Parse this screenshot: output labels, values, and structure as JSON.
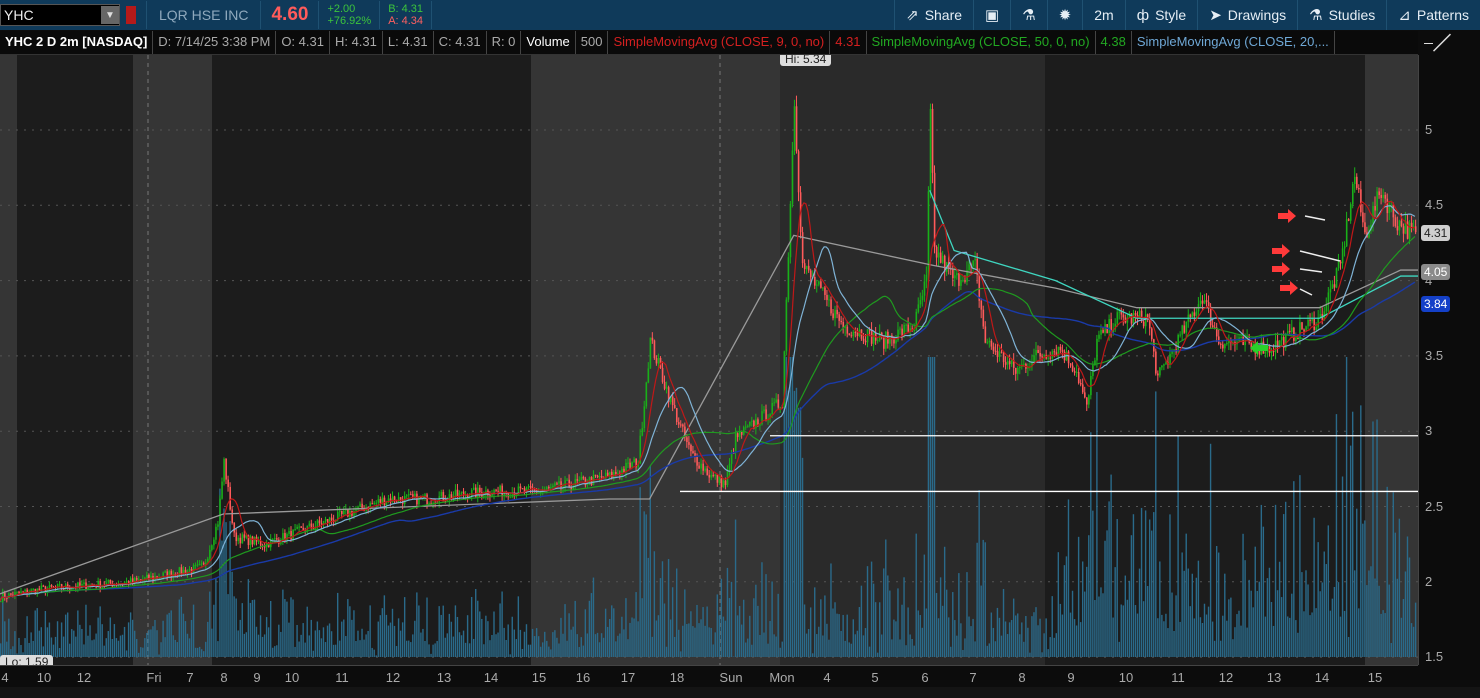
{
  "header": {
    "symbol": "YHC",
    "company": "LQR HSE INC",
    "last": "4.60",
    "change": "+2.00",
    "change_pct": "+76.92%",
    "bid": "B: 4.31",
    "ask": "A: 4.34"
  },
  "toolbar": {
    "share": "Share",
    "timeframe": "2m",
    "style": "Style",
    "drawings": "Drawings",
    "studies": "Studies",
    "patterns": "Patterns"
  },
  "studybar": {
    "title": "YHC 2 D 2m [NASDAQ]",
    "date": "D: 7/14/25 3:38 PM",
    "open": "O: 4.31",
    "high": "H: 4.31",
    "low": "L: 4.31",
    "close": "C: 4.31",
    "range": "R: 0",
    "volume_label": "Volume",
    "volume": "500",
    "sma9": "SimpleMovingAvg (CLOSE, 9, 0, no)",
    "sma9_val": "4.31",
    "sma50": "SimpleMovingAvg (CLOSE, 50, 0, no)",
    "sma50_val": "4.38",
    "sma20": "SimpleMovingAvg (CLOSE, 20,..."
  },
  "chart": {
    "hi_label": "Hi: 5.34",
    "lo_label": "Lo: 1.59",
    "price_ticks": [
      "5",
      "4.5",
      "4",
      "3.5",
      "3",
      "2.5",
      "2",
      "1.5"
    ],
    "price_tick_values": [
      5,
      4.5,
      4,
      3.5,
      3,
      2.5,
      2,
      1.5
    ],
    "markers": [
      {
        "label": "4.31",
        "value": 4.31,
        "bg": "#cfcfcf",
        "fg": "#222"
      },
      {
        "label": "4.05",
        "value": 4.05,
        "bg": "#8a8a8a",
        "fg": "#fff"
      },
      {
        "label": "3.84",
        "value": 3.84,
        "bg": "#1440c8",
        "fg": "#fff"
      }
    ],
    "time_labels": [
      "4",
      "10",
      "12",
      "Fri",
      "7",
      "8",
      "9",
      "10",
      "11",
      "12",
      "13",
      "14",
      "15",
      "16",
      "17",
      "18",
      "Sun",
      "Mon",
      "4",
      "5",
      "6",
      "7",
      "8",
      "9",
      "10",
      "11",
      "12",
      "13",
      "14",
      "15"
    ],
    "horizontal_lines": [
      2.97,
      2.6
    ],
    "colors": {
      "up": "#19b019",
      "down": "#ff5a5a",
      "sma9": "#c01818",
      "sma20": "#7fb3d6",
      "sma50": "#1f9a1f",
      "sma200": "#1a3aa8",
      "vwap_grey": "#9a9a9a",
      "vwap_teal": "#3fd6c0",
      "volume": "#2a6a8a"
    }
  },
  "chart_data": {
    "type": "candlestick",
    "ylim": [
      1.45,
      5.5
    ],
    "price_keypoints": [
      [
        0,
        1.9
      ],
      [
        20,
        1.95
      ],
      [
        65,
        2.0
      ],
      [
        100,
        2.1
      ],
      [
        107,
        2.4
      ],
      [
        110,
        2.8
      ],
      [
        115,
        2.3
      ],
      [
        130,
        2.25
      ],
      [
        150,
        2.35
      ],
      [
        170,
        2.45
      ],
      [
        190,
        2.55
      ],
      [
        210,
        2.55
      ],
      [
        240,
        2.6
      ],
      [
        265,
        2.6
      ],
      [
        300,
        2.7
      ],
      [
        314,
        2.8
      ],
      [
        320,
        3.6
      ],
      [
        330,
        3.2
      ],
      [
        340,
        2.85
      ],
      [
        350,
        2.7
      ],
      [
        357,
        2.65
      ],
      [
        362,
        2.95
      ],
      [
        385,
        3.2
      ],
      [
        391,
        5.2
      ],
      [
        395,
        4.1
      ],
      [
        405,
        3.9
      ],
      [
        415,
        3.7
      ],
      [
        435,
        3.6
      ],
      [
        450,
        3.7
      ],
      [
        456,
        4.0
      ],
      [
        458,
        5.1
      ],
      [
        460,
        4.2
      ],
      [
        470,
        4.0
      ],
      [
        480,
        4.1
      ],
      [
        485,
        3.6
      ],
      [
        500,
        3.4
      ],
      [
        510,
        3.5
      ],
      [
        522,
        3.55
      ],
      [
        530,
        3.4
      ],
      [
        535,
        3.15
      ],
      [
        540,
        3.6
      ],
      [
        550,
        3.75
      ],
      [
        565,
        3.75
      ],
      [
        570,
        3.35
      ],
      [
        580,
        3.6
      ],
      [
        592,
        3.9
      ],
      [
        600,
        3.6
      ],
      [
        625,
        3.55
      ],
      [
        650,
        3.75
      ],
      [
        660,
        4.1
      ],
      [
        667,
        4.7
      ],
      [
        672,
        4.3
      ],
      [
        680,
        4.6
      ],
      [
        687,
        4.4
      ],
      [
        697,
        4.3
      ]
    ],
    "grey_line_keypoints": [
      [
        0,
        1.92
      ],
      [
        110,
        2.45
      ],
      [
        300,
        2.55
      ],
      [
        320,
        2.55
      ],
      [
        391,
        4.3
      ],
      [
        460,
        4.1
      ],
      [
        520,
        3.95
      ],
      [
        560,
        3.82
      ],
      [
        650,
        3.82
      ],
      [
        690,
        4.07
      ],
      [
        710,
        4.07
      ]
    ],
    "teal_line_keypoints": [
      [
        458,
        4.6
      ],
      [
        470,
        4.2
      ],
      [
        520,
        4.0
      ],
      [
        560,
        3.75
      ],
      [
        650,
        3.75
      ],
      [
        690,
        4.03
      ],
      [
        710,
        4.03
      ]
    ]
  }
}
